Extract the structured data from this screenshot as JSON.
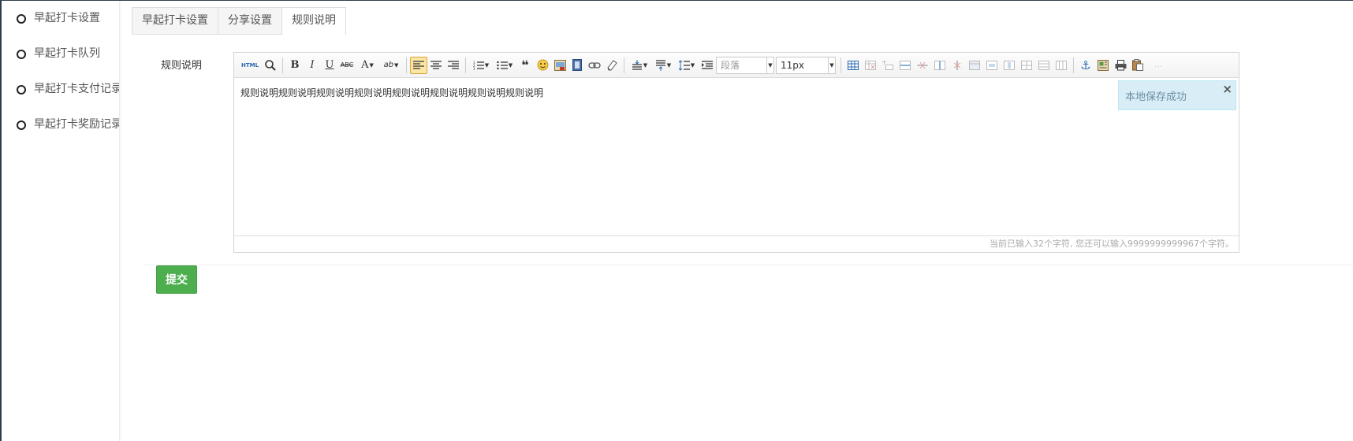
{
  "sidebar": {
    "items": [
      {
        "label": "早起打卡设置"
      },
      {
        "label": "早起打卡队列"
      },
      {
        "label": "早起打卡支付记录"
      },
      {
        "label": "早起打卡奖励记录"
      }
    ]
  },
  "tabs": [
    {
      "label": "早起打卡设置",
      "active": false
    },
    {
      "label": "分享设置",
      "active": false
    },
    {
      "label": "规则说明",
      "active": true
    }
  ],
  "form": {
    "label": "规则说明",
    "submit_label": "提交"
  },
  "editor": {
    "content": "规则说明规则说明规则说明规则说明规则说明规则说明规则说明规则说明",
    "paragraph_select": "段落",
    "fontsize_select": "11px",
    "html_label": "HTML",
    "wordcount": "当前已输入32个字符, 您还可以输入9999999999967个字符。"
  },
  "toast": {
    "message": "本地保存成功",
    "close": "×"
  },
  "colors": {
    "submit_bg": "#4cae4c",
    "toast_bg": "#d9edf7",
    "frame": "#2f3f4f"
  }
}
